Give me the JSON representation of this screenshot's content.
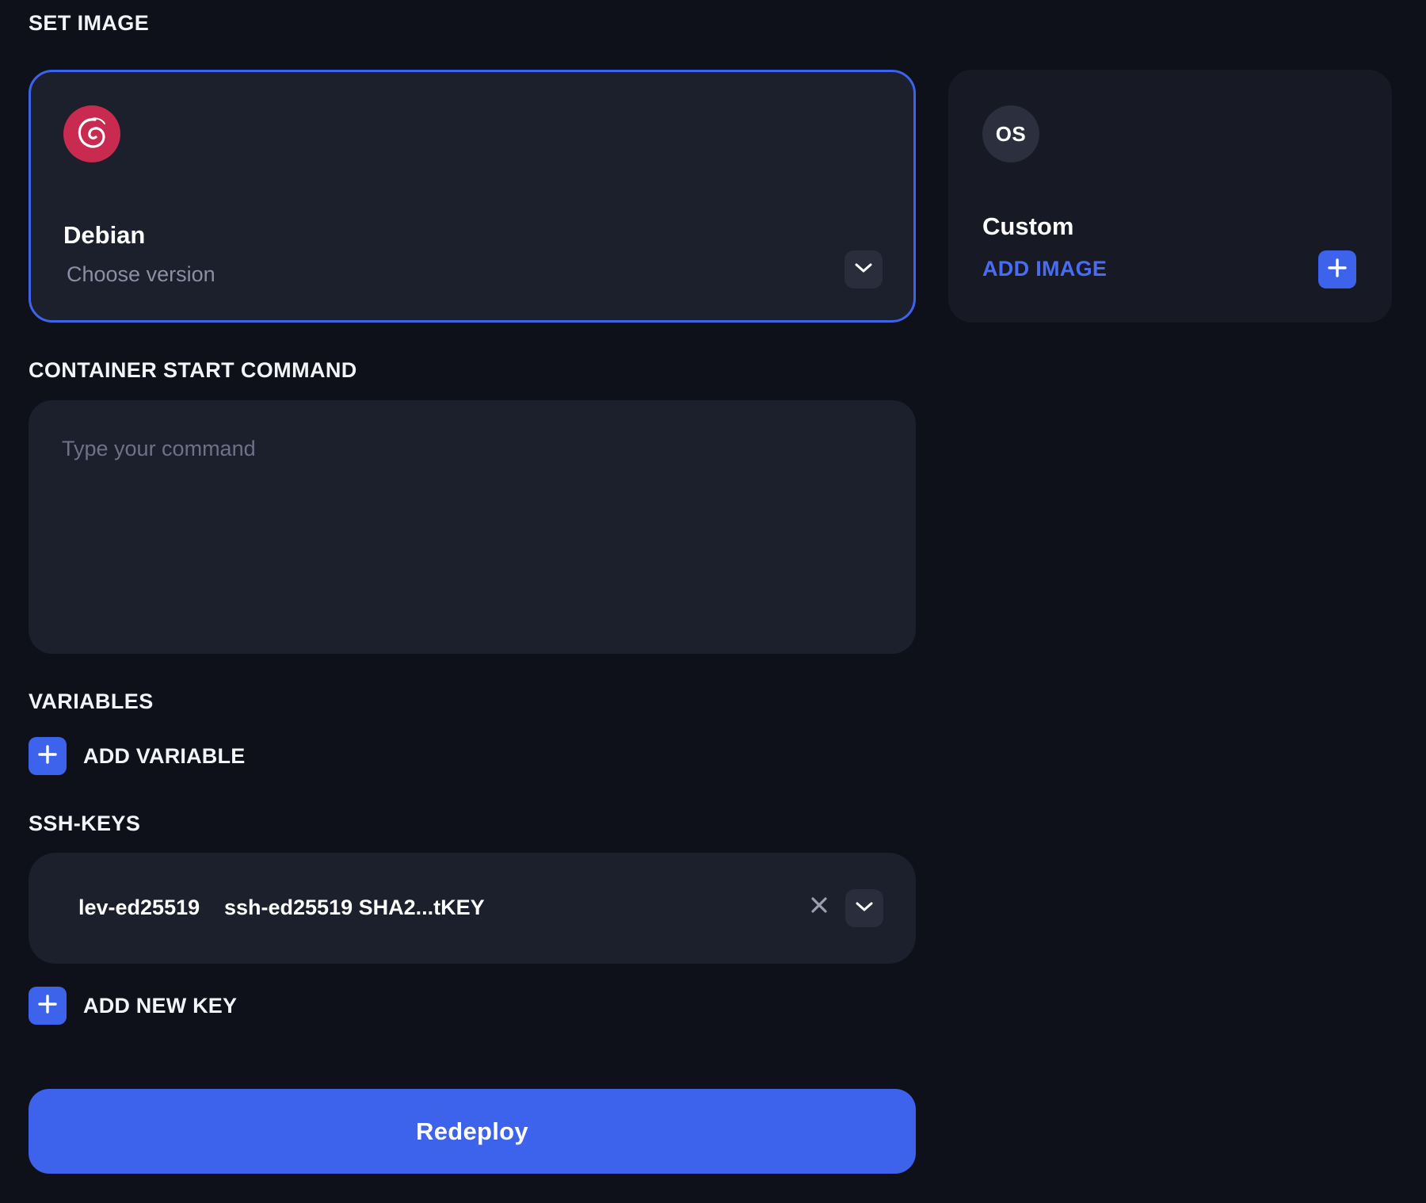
{
  "set_image": {
    "title": "SET IMAGE",
    "selected_card": {
      "name": "Debian",
      "version_placeholder": "Choose version",
      "logo_icon": "debian-swirl-icon",
      "chevron_icon": "chevron-down-icon"
    },
    "custom_card": {
      "badge": "OS",
      "name": "Custom",
      "add_image_label": "ADD IMAGE",
      "add_icon": "plus-icon"
    }
  },
  "container_start_command": {
    "title": "CONTAINER START COMMAND",
    "value": "",
    "placeholder": "Type your command"
  },
  "variables": {
    "title": "VARIABLES",
    "add_label": "ADD VARIABLE"
  },
  "ssh_keys": {
    "title": "SSH-KEYS",
    "items": [
      {
        "name": "lev-ed25519",
        "fingerprint": "ssh-ed25519 SHA2...tKEY"
      }
    ],
    "add_label": "ADD NEW KEY"
  },
  "actions": {
    "redeploy_label": "Redeploy"
  },
  "colors": {
    "background": "#0e111a",
    "card": "#1c1f2c",
    "accent": "#3d63ec",
    "accent_text": "#4a6cf3",
    "debian_red": "#c92a4f",
    "muted_text": "#8a8fa3"
  }
}
